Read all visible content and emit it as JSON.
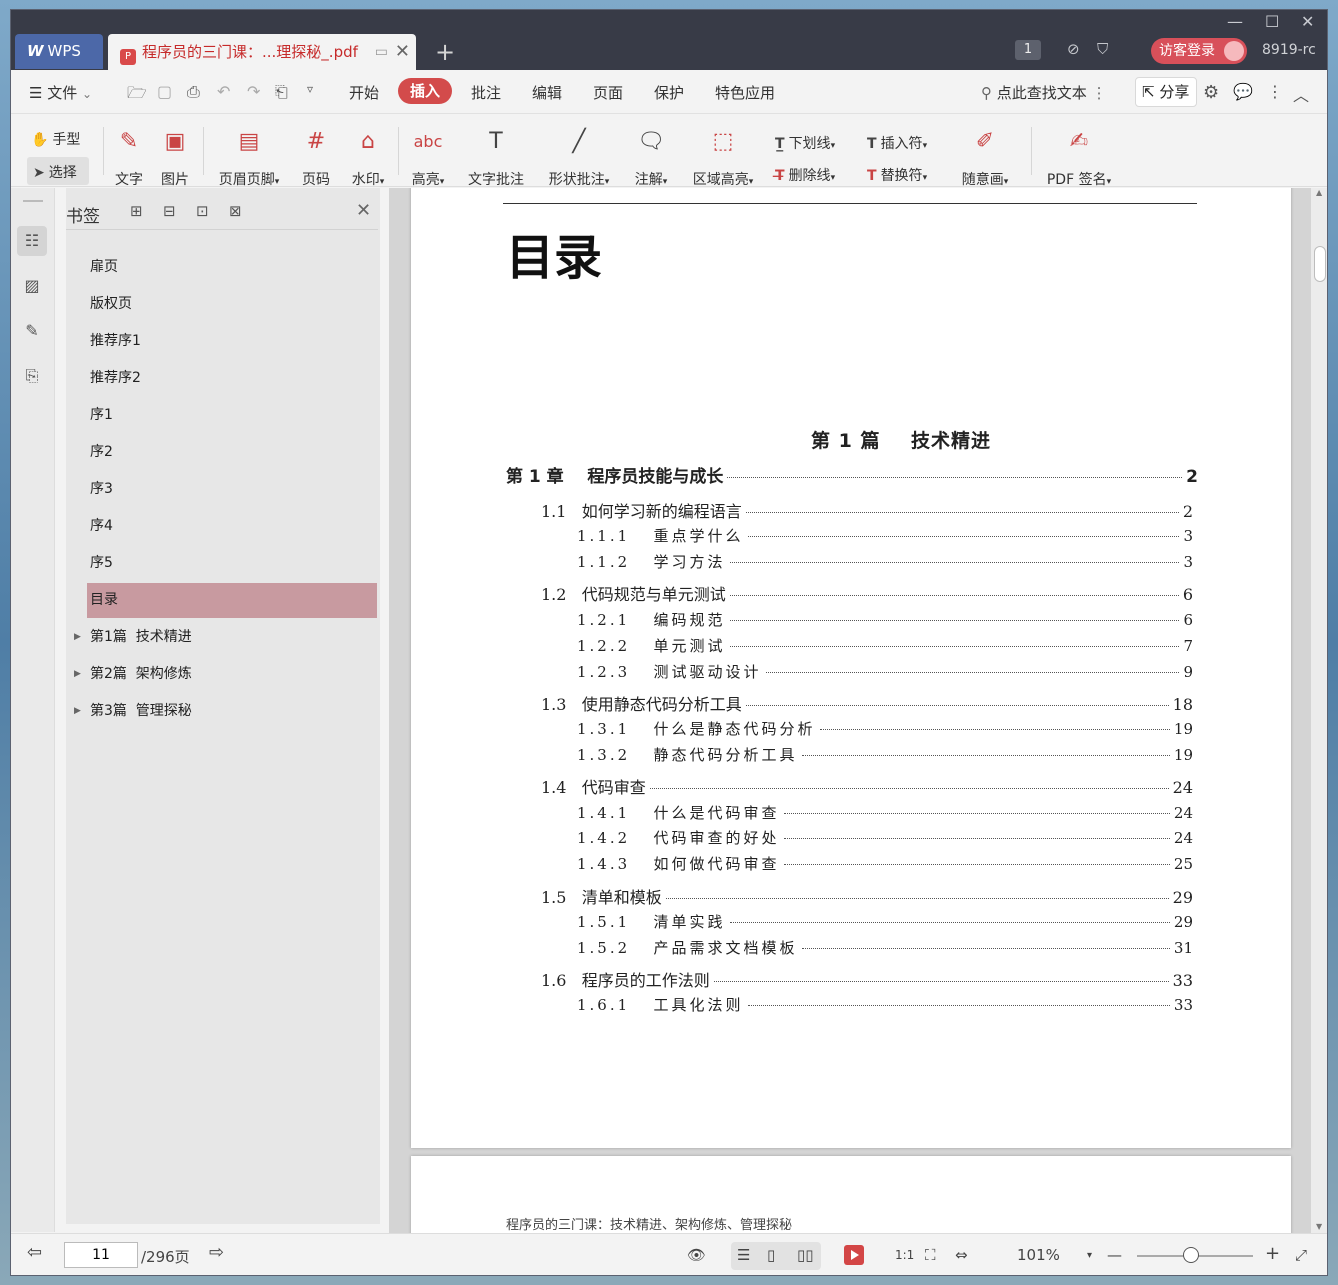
{
  "titlebar": {
    "wps_label": "WPS",
    "doc_tab_title": "程序员的三门课：...理探秘_.pdf",
    "page_badge": "1",
    "login_label": "访客登录",
    "user_name": "8919-rc"
  },
  "menubar": {
    "file_label": "文件",
    "items": [
      "开始",
      "插入",
      "批注",
      "编辑",
      "页面",
      "保护",
      "特色应用"
    ],
    "active_item": "插入",
    "search_label": "点此查找文本",
    "share_label": "分享"
  },
  "toolbar": {
    "hand_label": "手型",
    "select_label": "选择",
    "text_label": "文字",
    "image_label": "图片",
    "header_footer_label": "页眉页脚",
    "page_number_label": "页码",
    "watermark_label": "水印",
    "highlight_label": "高亮",
    "text_comment_label": "文字批注",
    "shape_comment_label": "形状批注",
    "note_label": "注解",
    "area_highlight_label": "区域高亮",
    "underline_label": "下划线",
    "strikethrough_label": "删除线",
    "insert_char_label": "插入符",
    "replace_char_label": "替换符",
    "freehand_label": "随意画",
    "pdf_sign_label": "PDF 签名"
  },
  "bookmarks": {
    "title": "书签",
    "items": [
      "扉页",
      "版权页",
      "推荐序1",
      "推荐序2",
      "序1",
      "序2",
      "序3",
      "序4",
      "序5",
      "目录",
      "第1篇  技术精进",
      "第2篇  架构修炼",
      "第3篇  管理探秘"
    ],
    "selected": "目录"
  },
  "document": {
    "toc_title": "目录",
    "part_title": "第 1 篇    技术精进",
    "chapter": {
      "title": "第 1 章    程序员技能与成长",
      "page": "2"
    },
    "entries": [
      {
        "num": "1.1",
        "title": "如何学习新的编程语言",
        "page": "2",
        "level": 1
      },
      {
        "num": "1.1.1",
        "title": "重点学什么",
        "page": "3",
        "level": 2
      },
      {
        "num": "1.1.2",
        "title": "学习方法",
        "page": "3",
        "level": 2
      },
      {
        "num": "1.2",
        "title": "代码规范与单元测试",
        "page": "6",
        "level": 1
      },
      {
        "num": "1.2.1",
        "title": "编码规范",
        "page": "6",
        "level": 2
      },
      {
        "num": "1.2.2",
        "title": "单元测试",
        "page": "7",
        "level": 2
      },
      {
        "num": "1.2.3",
        "title": "测试驱动设计",
        "page": "9",
        "level": 2
      },
      {
        "num": "1.3",
        "title": "使用静态代码分析工具",
        "page": "18",
        "level": 1
      },
      {
        "num": "1.3.1",
        "title": "什么是静态代码分析",
        "page": "19",
        "level": 2
      },
      {
        "num": "1.3.2",
        "title": "静态代码分析工具",
        "page": "19",
        "level": 2
      },
      {
        "num": "1.4",
        "title": "代码审查",
        "page": "24",
        "level": 1
      },
      {
        "num": "1.4.1",
        "title": "什么是代码审查",
        "page": "24",
        "level": 2
      },
      {
        "num": "1.4.2",
        "title": "代码审查的好处",
        "page": "24",
        "level": 2
      },
      {
        "num": "1.4.3",
        "title": "如何做代码审查",
        "page": "25",
        "level": 2
      },
      {
        "num": "1.5",
        "title": "清单和模板",
        "page": "29",
        "level": 1
      },
      {
        "num": "1.5.1",
        "title": "清单实践",
        "page": "29",
        "level": 2
      },
      {
        "num": "1.5.2",
        "title": "产品需求文档模板",
        "page": "31",
        "level": 2
      },
      {
        "num": "1.6",
        "title": "程序员的工作法则",
        "page": "33",
        "level": 1
      },
      {
        "num": "1.6.1",
        "title": "工具化法则",
        "page": "33",
        "level": 2
      }
    ],
    "next_page_header": "程序员的三门课：技术精进、架构修炼、管理探秘"
  },
  "statusbar": {
    "current_page": "11",
    "total_pages": "/296页",
    "zoom": "101%",
    "zoom_fraction": 0.4
  },
  "colors": {
    "accent": "#d34b4b",
    "titlebar": "#383b47",
    "selected_bookmark": "#c89aa0"
  }
}
